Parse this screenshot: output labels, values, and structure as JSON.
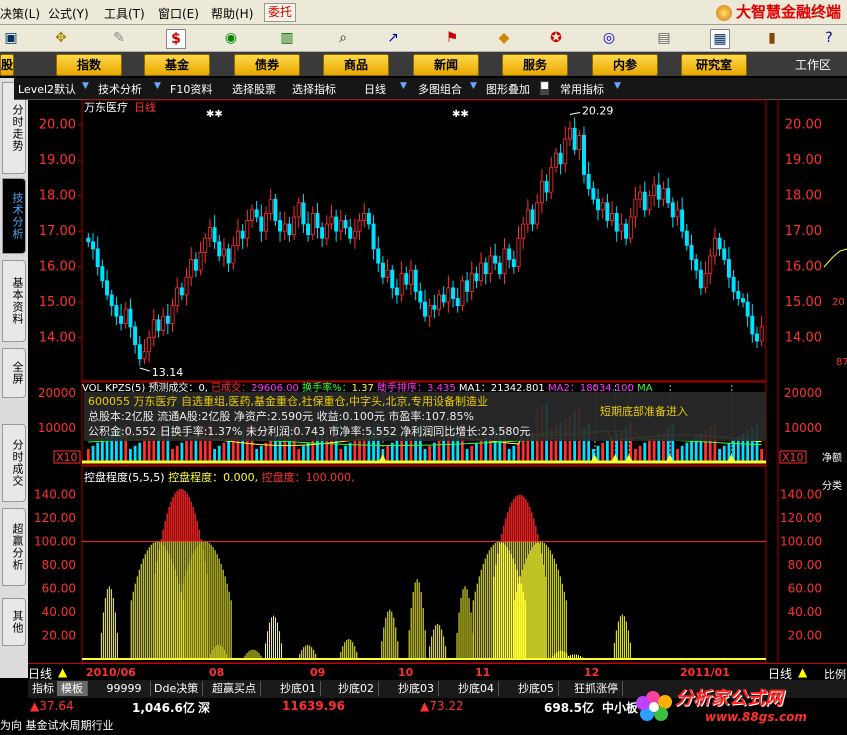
{
  "menu": {
    "items": [
      "决策(L)",
      "公式(Y)",
      "工具(T)",
      "窗口(E)",
      "帮助(H)"
    ],
    "weituo": "委托",
    "brand": "大智慧金融终端"
  },
  "nav": {
    "buttons": [
      "股",
      "指数",
      "基金",
      "债券",
      "商品",
      "新闻",
      "服务",
      "内参",
      "研究室"
    ],
    "workspace": "工作区"
  },
  "funcbar": {
    "items": [
      "Level2默认",
      "技术分析",
      "F10资料",
      "选择股票",
      "选择指标",
      "日线",
      "多图组合",
      "图形叠加",
      "常用指标"
    ]
  },
  "lefttabs": [
    "分时走势",
    "技术分析",
    "基本资料",
    "全屏",
    "分时成交",
    "超赢分析",
    "其他"
  ],
  "stock": {
    "name": "万东医疗",
    "period": "日线",
    "high_label": "20.29",
    "low_label": "13.14"
  },
  "price_axis": [
    "20.00",
    "19.00",
    "18.00",
    "17.00",
    "16.00",
    "15.00",
    "14.00"
  ],
  "vol_axis": [
    "20000",
    "10000",
    "X10"
  ],
  "kz_axis": [
    "140.00",
    "120.00",
    "100.00",
    "80.00",
    "60.00",
    "40.00",
    "20.00"
  ],
  "volume_panel": {
    "title": "VOL KPZS(5)",
    "pred_label": "预测成交：",
    "pred_value": "0,",
    "done_label": "已成交：",
    "done_value": "29606.00",
    "turnover_label": "换手率%：",
    "turnover_value": "1.37",
    "rank_label": "助手排序：",
    "rank_value": "3.435",
    "ma1_label": "MA1：",
    "ma1_value": "21342.801",
    "ma2_label": "MA2：",
    "ma2_value": "18034.100",
    "ma3_label": "MA"
  },
  "popup": {
    "line1": "600055 万东医疗 自选重组,医药,基金重仓,社保重仓,中字头,北京,专用设备制造业",
    "line2": "总股本:2亿股 流通A股:2亿股  净资产:2.590元  收益:0.100元  市盈率:107.85%",
    "line3": "公积金:0.552  日换手率:1.37%  未分利润:0.743  市净率:5.552  净利润同比增长:23.580元",
    "signal": "短期底部准备进入"
  },
  "kz_panel": {
    "title": "控盘程度(5,5,5)",
    "label1": "控盘程度：",
    "value1": "0.000,",
    "label2": "控盘度：",
    "value2": "100.000,"
  },
  "right_edge": {
    "p1": "20",
    "p2": "87",
    "v1": "净额",
    "k1": "分类",
    "b1": "比例"
  },
  "datebar": {
    "period": "日线",
    "dates": [
      "2010/06",
      "08",
      "09",
      "10",
      "11",
      "12",
      "2011/01"
    ],
    "right_period": "日线"
  },
  "bottom_tabs": [
    "指标",
    "模板",
    "99999",
    "Dde决策",
    "超赢买点",
    "抄底01",
    "抄底02",
    "抄底03",
    "抄底04",
    "抄底05",
    "狂抓涨停"
  ],
  "status": {
    "s1": "▲37.64",
    "s2": "1,046.6亿",
    "s3": "深",
    "s4": "11639.96",
    "s5": "▲73.22",
    "s6": "698.5亿",
    "s7": "中小板",
    "ticker": "为向 基金试水周期行业"
  },
  "watermark": {
    "name": "分析家公式网",
    "url": "www.88gs.com"
  },
  "colors": {
    "up": "#ff3030",
    "down": "#00e0ff",
    "bar_yellow": "#ffff30",
    "bar_red": "#e02020",
    "grid_red": "#aa0000"
  },
  "chart_data": {
    "type": "candlestick",
    "title": "万东医疗 日线",
    "x": [
      "2010/06",
      "08",
      "09",
      "10",
      "11",
      "12",
      "2011/01"
    ],
    "ylim": [
      13.0,
      20.5
    ],
    "high": 20.29,
    "low": 13.14,
    "close_series": [
      16.7,
      16.5,
      16.0,
      15.6,
      15.2,
      14.9,
      14.6,
      14.4,
      14.8,
      14.3,
      13.8,
      13.4,
      13.6,
      14.0,
      14.5,
      14.2,
      14.6,
      14.4,
      14.9,
      15.4,
      15.2,
      15.7,
      16.2,
      15.9,
      16.4,
      16.8,
      17.1,
      16.7,
      16.3,
      16.5,
      16.1,
      16.6,
      17.0,
      16.8,
      17.3,
      17.6,
      17.4,
      17.0,
      17.5,
      17.9,
      17.3,
      17.0,
      17.2,
      16.9,
      17.4,
      17.8,
      17.2,
      16.9,
      17.5,
      17.1,
      16.8,
      17.2,
      17.4,
      17.0,
      17.3,
      17.1,
      16.8,
      17.0,
      17.3,
      17.5,
      17.2,
      16.5,
      16.1,
      15.7,
      15.9,
      15.4,
      15.2,
      15.8,
      15.5,
      15.9,
      15.3,
      15.0,
      14.6,
      14.9,
      14.8,
      15.2,
      15.0,
      15.4,
      15.1,
      14.9,
      15.6,
      15.3,
      15.8,
      15.6,
      16.1,
      15.8,
      16.3,
      16.1,
      15.8,
      16.5,
      16.2,
      16.0,
      16.8,
      17.2,
      17.6,
      17.2,
      17.8,
      18.4,
      18.1,
      18.8,
      19.2,
      18.9,
      19.6,
      19.9,
      19.3,
      19.7,
      18.6,
      18.2,
      17.9,
      17.6,
      17.8,
      17.3,
      17.5,
      17.0,
      17.2,
      16.8,
      17.4,
      17.9,
      18.1,
      17.6,
      18.0,
      18.3,
      17.9,
      18.2,
      17.8,
      17.4,
      17.6,
      17.0,
      16.6,
      16.2,
      15.9,
      15.4,
      15.8,
      16.3,
      16.8,
      16.5,
      16.2,
      15.7,
      15.3,
      15.1,
      15.0,
      14.6,
      14.1,
      13.9,
      14.3
    ],
    "volume_ylim": [
      0,
      20000
    ],
    "kz_ylim": [
      0,
      150
    ],
    "kz_reference": 100,
    "kz_peaks": [
      [
        0.04,
        62
      ],
      [
        0.11,
        100
      ],
      [
        0.145,
        145
      ],
      [
        0.18,
        100
      ],
      [
        0.2,
        12
      ],
      [
        0.25,
        8
      ],
      [
        0.28,
        37
      ],
      [
        0.33,
        12
      ],
      [
        0.39,
        17
      ],
      [
        0.45,
        42
      ],
      [
        0.49,
        68
      ],
      [
        0.52,
        30
      ],
      [
        0.56,
        62
      ],
      [
        0.61,
        100
      ],
      [
        0.64,
        140
      ],
      [
        0.67,
        100
      ],
      [
        0.7,
        7
      ],
      [
        0.72,
        4
      ],
      [
        0.79,
        38
      ]
    ]
  }
}
